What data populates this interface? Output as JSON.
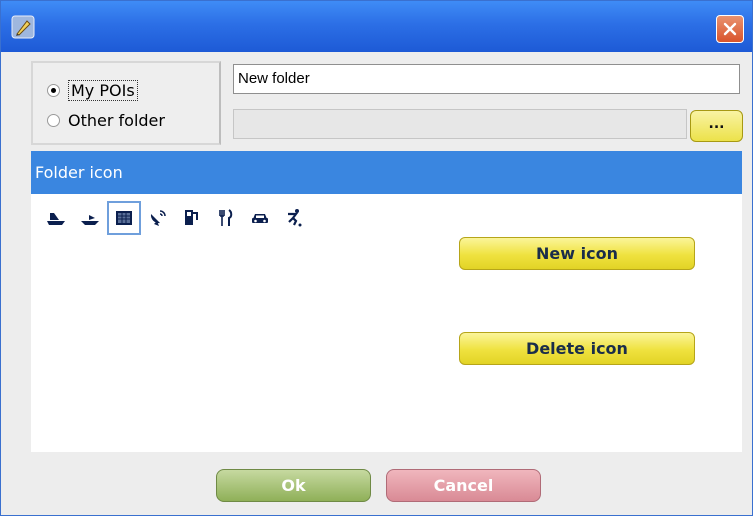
{
  "window": {
    "title": "",
    "app_icon": "pen-icon",
    "close_icon": "close-icon",
    "accent_color": "#2c6fe6"
  },
  "folder_choice": {
    "options": [
      {
        "label": "My POIs",
        "checked": true
      },
      {
        "label": "Other folder",
        "checked": false
      }
    ]
  },
  "name_field": {
    "value": "New folder"
  },
  "path_field": {
    "value": ""
  },
  "browse_button": {
    "label": "..."
  },
  "icon_panel": {
    "header": "Folder icon",
    "header_color": "#3a86e0",
    "icons": [
      {
        "name": "ship-icon",
        "glyph": "⛴",
        "selected": false
      },
      {
        "name": "boat-icon",
        "glyph": "⛵",
        "selected": false
      },
      {
        "name": "grid-icon",
        "glyph": "▦",
        "selected": true
      },
      {
        "name": "satellite-dish-icon",
        "glyph": "📡",
        "selected": false
      },
      {
        "name": "fuel-pump-icon",
        "glyph": "⛽",
        "selected": false
      },
      {
        "name": "restaurant-icon",
        "glyph": "🍴",
        "selected": false
      },
      {
        "name": "car-icon",
        "glyph": "🚘",
        "selected": false
      },
      {
        "name": "skier-icon",
        "glyph": "⛷",
        "selected": false
      }
    ],
    "new_icon_label": "New icon",
    "delete_icon_label": "Delete icon"
  },
  "footer": {
    "ok_label": "Ok",
    "cancel_label": "Cancel"
  }
}
